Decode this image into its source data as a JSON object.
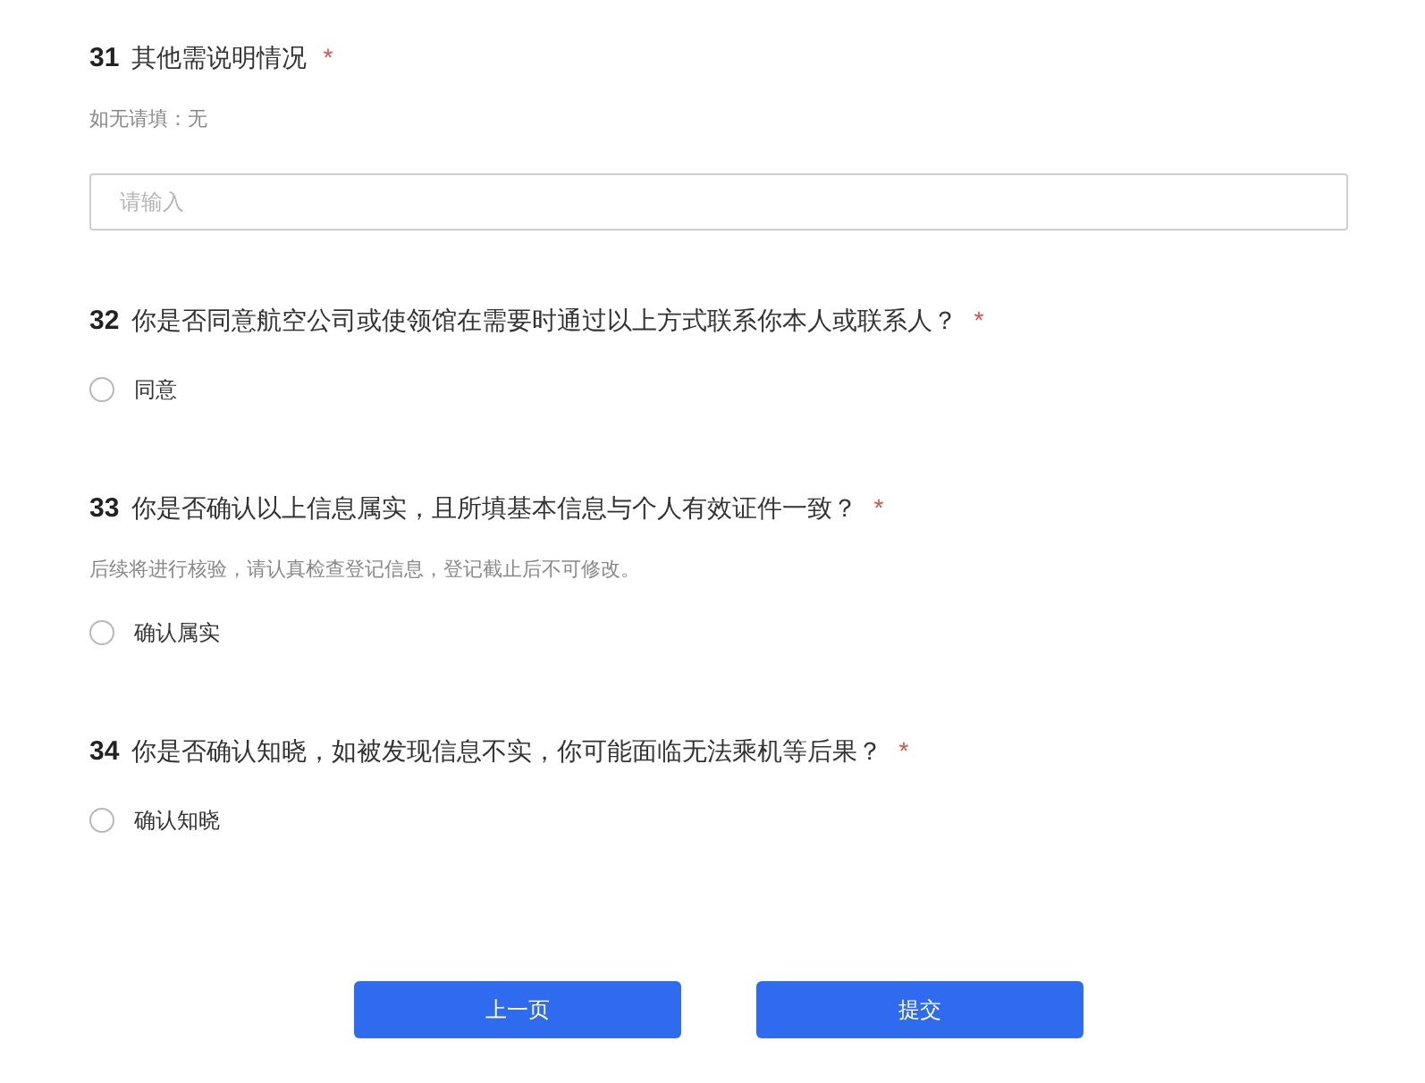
{
  "questions": [
    {
      "number": "31",
      "title": "其他需说明情况",
      "required_mark": "*",
      "hint": "如无请填：无",
      "kind": "text",
      "placeholder": "请输入"
    },
    {
      "number": "32",
      "title": "你是否同意航空公司或使领馆在需要时通过以上方式联系你本人或联系人？",
      "required_mark": "*",
      "kind": "radio",
      "options": [
        {
          "label": "同意",
          "selected": false
        }
      ]
    },
    {
      "number": "33",
      "title": "你是否确认以上信息属实，且所填基本信息与个人有效证件一致？",
      "required_mark": "*",
      "hint": "后续将进行核验，请认真检查登记信息，登记截止后不可修改。",
      "kind": "radio",
      "options": [
        {
          "label": "确认属实",
          "selected": false
        }
      ]
    },
    {
      "number": "34",
      "title": "你是否确认知晓，如被发现信息不实，你可能面临无法乘机等后果？",
      "required_mark": "*",
      "kind": "radio",
      "options": [
        {
          "label": "确认知晓",
          "selected": false
        }
      ]
    }
  ],
  "buttons": [
    {
      "label": "上一页"
    },
    {
      "label": "提交"
    }
  ]
}
